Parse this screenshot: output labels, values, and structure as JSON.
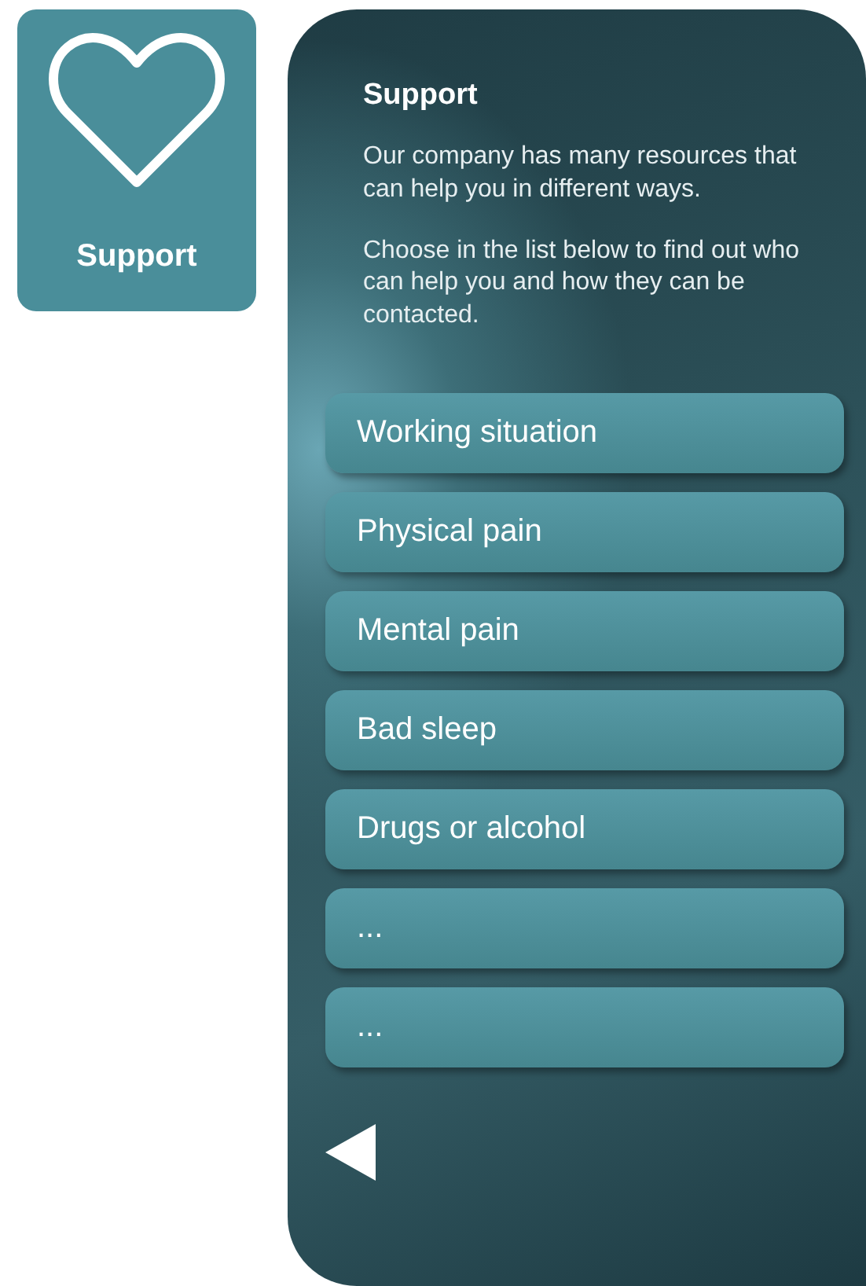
{
  "tile": {
    "label": "Support"
  },
  "panel": {
    "title": "Support",
    "paragraphs": [
      "Our company has many resources that can help you in different ways.",
      "Choose in the list below to find out who can help you and how they can be contacted."
    ],
    "items": [
      {
        "label": "Working situation"
      },
      {
        "label": "Physical pain"
      },
      {
        "label": "Mental pain"
      },
      {
        "label": "Bad sleep"
      },
      {
        "label": "Drugs or alcohol"
      },
      {
        "label": "..."
      },
      {
        "label": "..."
      }
    ]
  }
}
